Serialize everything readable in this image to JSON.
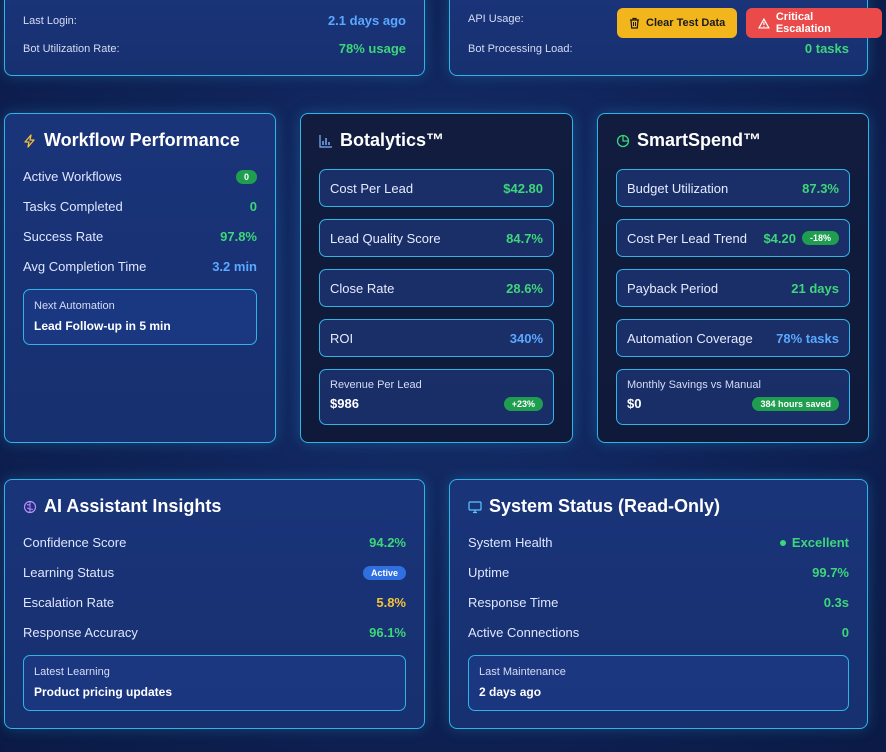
{
  "top_left": {
    "rows": [
      {
        "label": "Last Login:",
        "value": "2.1 days ago"
      },
      {
        "label": "Bot Utilization Rate:",
        "value": "78% usage"
      }
    ]
  },
  "top_right": {
    "rows": [
      {
        "label": "API Usage:",
        "value": ""
      },
      {
        "label": "Bot Processing Load:",
        "value": "0 tasks"
      }
    ],
    "clear_button": "Clear Test Data",
    "escalation_button": "Critical Escalation"
  },
  "workflow": {
    "title": "Workflow Performance",
    "icon": "lightning-icon",
    "rows": [
      {
        "label": "Active Workflows",
        "value": "0"
      },
      {
        "label": "Tasks Completed",
        "value": "0"
      },
      {
        "label": "Success Rate",
        "value": "97.8%"
      },
      {
        "label": "Avg Completion Time",
        "value": "3.2 min"
      }
    ],
    "next": {
      "label": "Next Automation",
      "value": "Lead Follow-up in 5 min"
    }
  },
  "botalytics": {
    "title": "Botalytics™",
    "icon": "bar-chart-icon",
    "metrics": [
      {
        "label": "Cost Per Lead",
        "value": "$42.80"
      },
      {
        "label": "Lead Quality Score",
        "value": "84.7%"
      },
      {
        "label": "Close Rate",
        "value": "28.6%"
      },
      {
        "label": "ROI",
        "value": "340%"
      }
    ],
    "revenue": {
      "label": "Revenue Per Lead",
      "value": "$986",
      "badge": "+23%"
    }
  },
  "smartspend": {
    "title": "SmartSpend™",
    "icon": "pie-chart-icon",
    "metrics": [
      {
        "label": "Budget Utilization",
        "value": "87.3%"
      },
      {
        "label": "Cost Per Lead Trend",
        "value": "$4.20",
        "badge": "-18%"
      },
      {
        "label": "Payback Period",
        "value": "21 days"
      },
      {
        "label": "Automation Coverage",
        "value": "78% tasks"
      }
    ],
    "savings": {
      "label": "Monthly Savings vs Manual",
      "value": "$0",
      "badge": "384 hours saved"
    }
  },
  "ai": {
    "title": "AI Assistant Insights",
    "icon": "brain-icon",
    "rows": [
      {
        "label": "Confidence Score",
        "value": "94.2%"
      },
      {
        "label": "Learning Status",
        "value": "Active"
      },
      {
        "label": "Escalation Rate",
        "value": "5.8%"
      },
      {
        "label": "Response Accuracy",
        "value": "96.1%"
      }
    ],
    "latest": {
      "label": "Latest Learning",
      "value": "Product pricing updates"
    }
  },
  "system": {
    "title": "System Status (Read-Only)",
    "icon": "monitor-icon",
    "rows": [
      {
        "label": "System Health",
        "value": "Excellent"
      },
      {
        "label": "Uptime",
        "value": "99.7%"
      },
      {
        "label": "Response Time",
        "value": "0.3s"
      },
      {
        "label": "Active Connections",
        "value": "0"
      }
    ],
    "maintenance": {
      "label": "Last Maintenance",
      "value": "2 days ago"
    }
  }
}
